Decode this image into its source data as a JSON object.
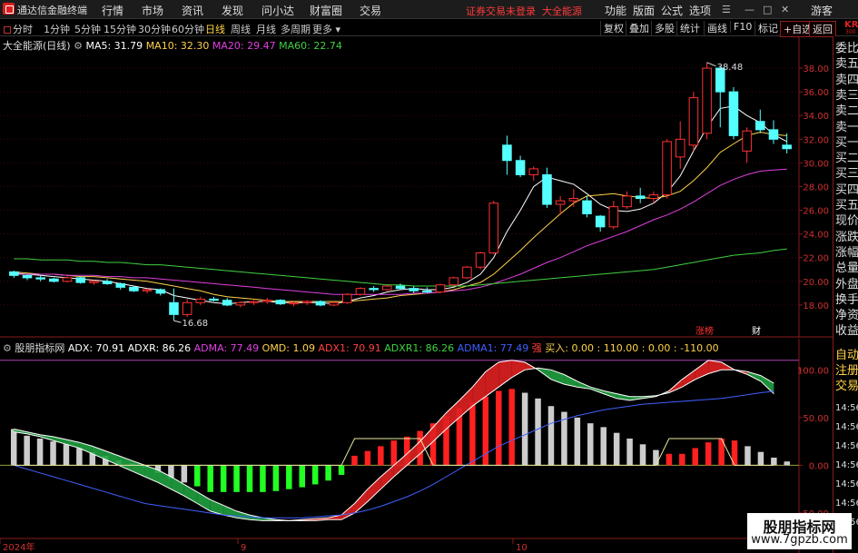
{
  "app": {
    "title": "通达信金融终端",
    "menu": [
      "行情",
      "市场",
      "资讯",
      "发现",
      "问小达",
      "财富圈",
      "交易"
    ],
    "login_notice": "证券交易未登录",
    "stock_name_top": "大全能源",
    "right_menu": [
      "功能",
      "版面",
      "公式",
      "选项"
    ],
    "guest": "游客",
    "brand_logo": "KR",
    "brand_sub": "300"
  },
  "periodbar": {
    "items": [
      "分时",
      "1分钟",
      "5分钟",
      "15分钟",
      "30分钟",
      "60分钟",
      "日线",
      "周线",
      "月线",
      "多周期",
      "更多"
    ],
    "active": "日线",
    "tools": [
      "复权",
      "叠加",
      "多股",
      "统计",
      "画线",
      "F10",
      "标记",
      "+自选",
      "返回"
    ]
  },
  "main_chart": {
    "stock_label": "大全能源(日线)",
    "ma_legend": [
      {
        "label": "MA5: 31.79",
        "color": "#ffffff"
      },
      {
        "label": "MA10: 32.30",
        "color": "#ffd24a"
      },
      {
        "label": "MA20: 29.47",
        "color": "#e040e0"
      },
      {
        "label": "MA60: 22.74",
        "color": "#40d040"
      }
    ],
    "high_label": "38.48",
    "low_label": "16.68",
    "badges": [
      "涨榜",
      "财"
    ]
  },
  "sub_chart": {
    "indicator_name": "股朋指标网",
    "legend": [
      {
        "label": "ADX: 70.91",
        "color": "#ffffff"
      },
      {
        "label": "ADXR: 86.26",
        "color": "#ffffff"
      },
      {
        "label": "ADMA: 77.49",
        "color": "#e040e0"
      },
      {
        "label": "OMD: 1.09",
        "color": "#ffd24a"
      },
      {
        "label": "ADX1: 70.91",
        "color": "#ff4040"
      },
      {
        "label": "ADXR1: 86.26",
        "color": "#40d040"
      },
      {
        "label": "ADMA1: 77.49",
        "color": "#4060ff"
      },
      {
        "label": "强",
        "color": "#ff4040"
      },
      {
        "label": "买入: 0.00",
        "color": "#ffd24a"
      },
      {
        "label": ": 110.00",
        "color": "#ffd24a"
      },
      {
        "label": ": 0.00",
        "color": "#ffd24a"
      },
      {
        "label": ": -110.00",
        "color": "#ffd24a"
      }
    ]
  },
  "sidepanel": {
    "top": [
      "委比",
      "卖五",
      "卖四",
      "卖三",
      "卖二",
      "卖一",
      "买一",
      "买二",
      "买三",
      "买四",
      "买五",
      "现价",
      "涨跌",
      "涨幅",
      "总量",
      "外盘",
      "换手",
      "净资",
      "收益"
    ],
    "bottom": [
      "自动",
      "注册",
      "交易"
    ],
    "times": [
      "14:56",
      "14:56",
      "14:56",
      "14:56",
      "14:56",
      "14:56",
      "14:56"
    ]
  },
  "date_axis": [
    "2024年",
    "9",
    "10"
  ],
  "watermark": {
    "title": "股朋指标网",
    "url": "www.7gpzb.com"
  },
  "chart_data": [
    {
      "type": "candlestick",
      "title": "大全能源(日线)",
      "yticks": [
        18.0,
        20.0,
        22.0,
        24.0,
        26.0,
        28.0,
        30.0,
        32.0,
        34.0,
        36.0,
        38.0
      ],
      "ylim": [
        16.0,
        39.0
      ],
      "candles": [
        [
          20.8,
          20.9,
          20.3,
          20.5
        ],
        [
          20.5,
          20.6,
          20.1,
          20.3
        ],
        [
          20.3,
          20.5,
          20.0,
          20.2
        ],
        [
          20.2,
          20.3,
          19.9,
          20.0
        ],
        [
          20.0,
          20.4,
          19.9,
          20.3
        ],
        [
          20.3,
          20.4,
          19.8,
          19.9
        ],
        [
          19.9,
          20.1,
          19.7,
          20.0
        ],
        [
          20.0,
          20.2,
          19.7,
          19.8
        ],
        [
          19.8,
          19.9,
          19.3,
          19.5
        ],
        [
          19.5,
          19.6,
          19.1,
          19.2
        ],
        [
          19.2,
          19.4,
          19.0,
          19.3
        ],
        [
          19.3,
          19.4,
          18.8,
          19.0
        ],
        [
          18.2,
          19.4,
          16.68,
          17.2
        ],
        [
          17.2,
          18.5,
          17.0,
          18.2
        ],
        [
          18.2,
          18.7,
          18.0,
          18.5
        ],
        [
          18.5,
          18.7,
          18.3,
          18.4
        ],
        [
          18.4,
          18.6,
          17.9,
          18.0
        ],
        [
          18.0,
          18.3,
          17.8,
          18.2
        ],
        [
          18.2,
          18.4,
          18.0,
          18.3
        ],
        [
          18.3,
          18.6,
          18.1,
          18.4
        ],
        [
          18.4,
          18.5,
          18.0,
          18.1
        ],
        [
          18.1,
          18.3,
          17.9,
          18.2
        ],
        [
          18.2,
          18.4,
          18.0,
          18.3
        ],
        [
          18.3,
          18.4,
          17.9,
          18.0
        ],
        [
          18.0,
          18.3,
          17.9,
          18.2
        ],
        [
          18.2,
          19.0,
          18.1,
          18.9
        ],
        [
          18.9,
          19.5,
          18.8,
          19.4
        ],
        [
          19.4,
          19.6,
          19.1,
          19.3
        ],
        [
          19.3,
          19.7,
          19.2,
          19.6
        ],
        [
          19.6,
          19.8,
          19.3,
          19.4
        ],
        [
          19.4,
          19.6,
          19.0,
          19.2
        ],
        [
          19.2,
          19.5,
          19.0,
          19.1
        ],
        [
          19.1,
          19.8,
          19.0,
          19.7
        ],
        [
          19.7,
          20.4,
          19.6,
          20.3
        ],
        [
          20.3,
          21.3,
          20.2,
          21.2
        ],
        [
          21.2,
          22.5,
          21.0,
          22.4
        ],
        [
          22.4,
          26.8,
          22.3,
          26.6
        ],
        [
          31.5,
          32.3,
          29.0,
          30.2
        ],
        [
          30.2,
          30.6,
          28.8,
          29.0
        ],
        [
          29.0,
          29.7,
          28.5,
          29.5
        ],
        [
          29.0,
          29.6,
          26.2,
          26.5
        ],
        [
          26.5,
          27.2,
          25.6,
          26.8
        ],
        [
          26.8,
          27.8,
          26.3,
          27.0
        ],
        [
          26.8,
          27.2,
          25.4,
          25.7
        ],
        [
          25.5,
          25.6,
          24.2,
          24.6
        ],
        [
          24.6,
          26.8,
          24.4,
          26.3
        ],
        [
          26.3,
          27.6,
          26.1,
          27.2
        ],
        [
          27.2,
          27.9,
          26.6,
          27.0
        ],
        [
          27.0,
          27.6,
          26.6,
          27.3
        ],
        [
          27.3,
          32.0,
          27.0,
          31.8
        ],
        [
          30.5,
          33.5,
          29.5,
          32.0
        ],
        [
          31.5,
          36.0,
          31.0,
          35.5
        ],
        [
          32.5,
          38.48,
          32.0,
          38.0
        ],
        [
          38.0,
          38.2,
          33.0,
          36.0
        ],
        [
          36.0,
          36.4,
          32.0,
          32.3
        ],
        [
          31.0,
          33.0,
          30.0,
          32.7
        ],
        [
          33.5,
          34.5,
          32.5,
          32.8
        ],
        [
          32.8,
          33.6,
          31.6,
          32.0
        ],
        [
          31.5,
          32.5,
          30.8,
          31.2
        ]
      ],
      "series": [
        {
          "name": "MA5",
          "color": "#ffffff",
          "values": [
            20.7,
            20.6,
            20.5,
            20.4,
            20.3,
            20.2,
            20.1,
            20.0,
            19.8,
            19.6,
            19.4,
            19.3,
            18.8,
            18.6,
            18.4,
            18.2,
            18.1,
            18.2,
            18.3,
            18.3,
            18.2,
            18.2,
            18.2,
            18.2,
            18.1,
            18.3,
            18.6,
            18.8,
            19.1,
            19.3,
            19.4,
            19.3,
            19.3,
            19.5,
            19.9,
            20.6,
            22.0,
            24.2,
            26.0,
            28.0,
            28.8,
            28.5,
            28.2,
            27.4,
            26.5,
            26.0,
            25.9,
            26.1,
            26.6,
            27.5,
            28.9,
            31.0,
            33.0,
            34.6,
            34.8,
            34.0,
            33.4,
            32.4,
            31.8
          ]
        },
        {
          "name": "MA10",
          "color": "#ffd24a",
          "values": [
            20.8,
            20.7,
            20.6,
            20.6,
            20.5,
            20.4,
            20.4,
            20.3,
            20.2,
            20.1,
            20.0,
            19.8,
            19.6,
            19.4,
            19.2,
            18.9,
            18.7,
            18.6,
            18.5,
            18.4,
            18.3,
            18.3,
            18.3,
            18.3,
            18.3,
            18.3,
            18.4,
            18.5,
            18.6,
            18.8,
            18.9,
            19.0,
            19.1,
            19.3,
            19.6,
            19.9,
            20.6,
            21.6,
            22.6,
            23.7,
            24.7,
            25.7,
            26.6,
            27.2,
            27.3,
            27.4,
            27.2,
            27.1,
            27.0,
            27.2,
            27.6,
            28.5,
            29.6,
            30.9,
            31.6,
            32.3,
            32.6,
            32.4,
            32.3
          ]
        },
        {
          "name": "MA20",
          "color": "#e040e0",
          "values": [
            20.6,
            20.6,
            20.6,
            20.6,
            20.5,
            20.5,
            20.5,
            20.4,
            20.4,
            20.3,
            20.3,
            20.2,
            20.1,
            20.0,
            19.9,
            19.8,
            19.7,
            19.6,
            19.5,
            19.4,
            19.3,
            19.2,
            19.1,
            19.0,
            18.9,
            18.9,
            18.9,
            18.9,
            18.9,
            18.9,
            19.0,
            19.0,
            19.1,
            19.2,
            19.3,
            19.5,
            19.8,
            20.2,
            20.6,
            21.1,
            21.6,
            22.0,
            22.5,
            23.0,
            23.4,
            23.8,
            24.2,
            24.7,
            25.2,
            25.6,
            26.1,
            26.7,
            27.4,
            28.1,
            28.6,
            29.0,
            29.3,
            29.4,
            29.47
          ]
        },
        {
          "name": "MA60",
          "color": "#40d040",
          "values": [
            21.9,
            21.9,
            21.8,
            21.8,
            21.8,
            21.7,
            21.7,
            21.6,
            21.6,
            21.5,
            21.4,
            21.4,
            21.3,
            21.2,
            21.1,
            21.0,
            20.9,
            20.8,
            20.7,
            20.6,
            20.5,
            20.4,
            20.3,
            20.2,
            20.1,
            20.0,
            19.9,
            19.8,
            19.7,
            19.7,
            19.6,
            19.6,
            19.6,
            19.6,
            19.6,
            19.7,
            19.8,
            19.9,
            20.0,
            20.1,
            20.2,
            20.3,
            20.4,
            20.5,
            20.6,
            20.7,
            20.8,
            20.9,
            21.0,
            21.2,
            21.4,
            21.6,
            21.8,
            22.0,
            22.2,
            22.3,
            22.4,
            22.6,
            22.74
          ]
        }
      ]
    },
    {
      "type": "bar",
      "title": "股朋指标网",
      "yticks": [
        -50.0,
        0.0,
        50.0,
        100.0
      ],
      "ylim": [
        -70.0,
        125.0
      ],
      "bars": [
        38,
        31,
        28,
        25,
        22,
        18,
        14,
        10,
        5,
        2,
        -2,
        -8,
        -14,
        -18,
        -22,
        -28,
        -28,
        -28,
        -28,
        -28,
        -27,
        -25,
        -23,
        -20,
        -16,
        -10,
        10,
        15,
        20,
        26,
        30,
        36,
        44,
        52,
        60,
        66,
        72,
        78,
        80,
        76,
        70,
        62,
        56,
        50,
        44,
        40,
        34,
        28,
        22,
        16,
        12,
        12,
        18,
        24,
        28,
        26,
        20,
        14,
        8,
        4
      ],
      "series": [
        {
          "name": "ADX",
          "color": "#ffffff",
          "values": [
            35,
            33,
            30,
            26,
            22,
            18,
            12,
            6,
            0,
            -6,
            -12,
            -18,
            -25,
            -32,
            -40,
            -48,
            -52,
            -55,
            -57,
            -58,
            -58,
            -58,
            -57,
            -56,
            -55,
            -52,
            -40,
            -25,
            -12,
            0,
            12,
            25,
            40,
            55,
            68,
            82,
            98,
            108,
            110,
            108,
            100,
            90,
            85,
            82,
            80,
            75,
            70,
            68,
            70,
            72,
            78,
            90,
            100,
            110,
            108,
            100,
            95,
            88,
            75
          ]
        },
        {
          "name": "ADXR",
          "color": "#ffffff",
          "values": [
            38,
            35,
            32,
            30,
            27,
            24,
            20,
            15,
            10,
            5,
            0,
            -5,
            -12,
            -20,
            -28,
            -36,
            -42,
            -48,
            -52,
            -55,
            -57,
            -58,
            -58,
            -58,
            -57,
            -57,
            -50,
            -38,
            -25,
            -12,
            0,
            12,
            25,
            38,
            50,
            62,
            72,
            82,
            92,
            100,
            102,
            100,
            95,
            88,
            82,
            78,
            75,
            72,
            72,
            73,
            76,
            82,
            90,
            96,
            100,
            100,
            98,
            94,
            86
          ]
        },
        {
          "name": "ADMA",
          "color": "#4060ff",
          "values": [
            0,
            -4,
            -8,
            -12,
            -16,
            -20,
            -24,
            -28,
            -32,
            -36,
            -40,
            -42,
            -44,
            -46,
            -48,
            -50,
            -52,
            -53,
            -54,
            -55,
            -55,
            -55,
            -55,
            -54,
            -53,
            -52,
            -50,
            -47,
            -43,
            -38,
            -33,
            -27,
            -20,
            -12,
            -4,
            4,
            12,
            20,
            26,
            32,
            38,
            44,
            48,
            52,
            55,
            58,
            60,
            62,
            64,
            65,
            66,
            67,
            68,
            69,
            70,
            72,
            74,
            76,
            77.49
          ]
        },
        {
          "name": "OMD",
          "color": "#ffd24a",
          "values": [
            0,
            0,
            0,
            0,
            0,
            0,
            0,
            0,
            0,
            0,
            0,
            0,
            0,
            0,
            0,
            0,
            0,
            0,
            0,
            0,
            0,
            0,
            0,
            0,
            0,
            0,
            28,
            28,
            28,
            28,
            28,
            28,
            0,
            0,
            0,
            0,
            0,
            0,
            0,
            0,
            0,
            0,
            0,
            0,
            0,
            0,
            0,
            0,
            0,
            0,
            28,
            28,
            28,
            28,
            28,
            0,
            0,
            0,
            0
          ]
        }
      ]
    }
  ]
}
